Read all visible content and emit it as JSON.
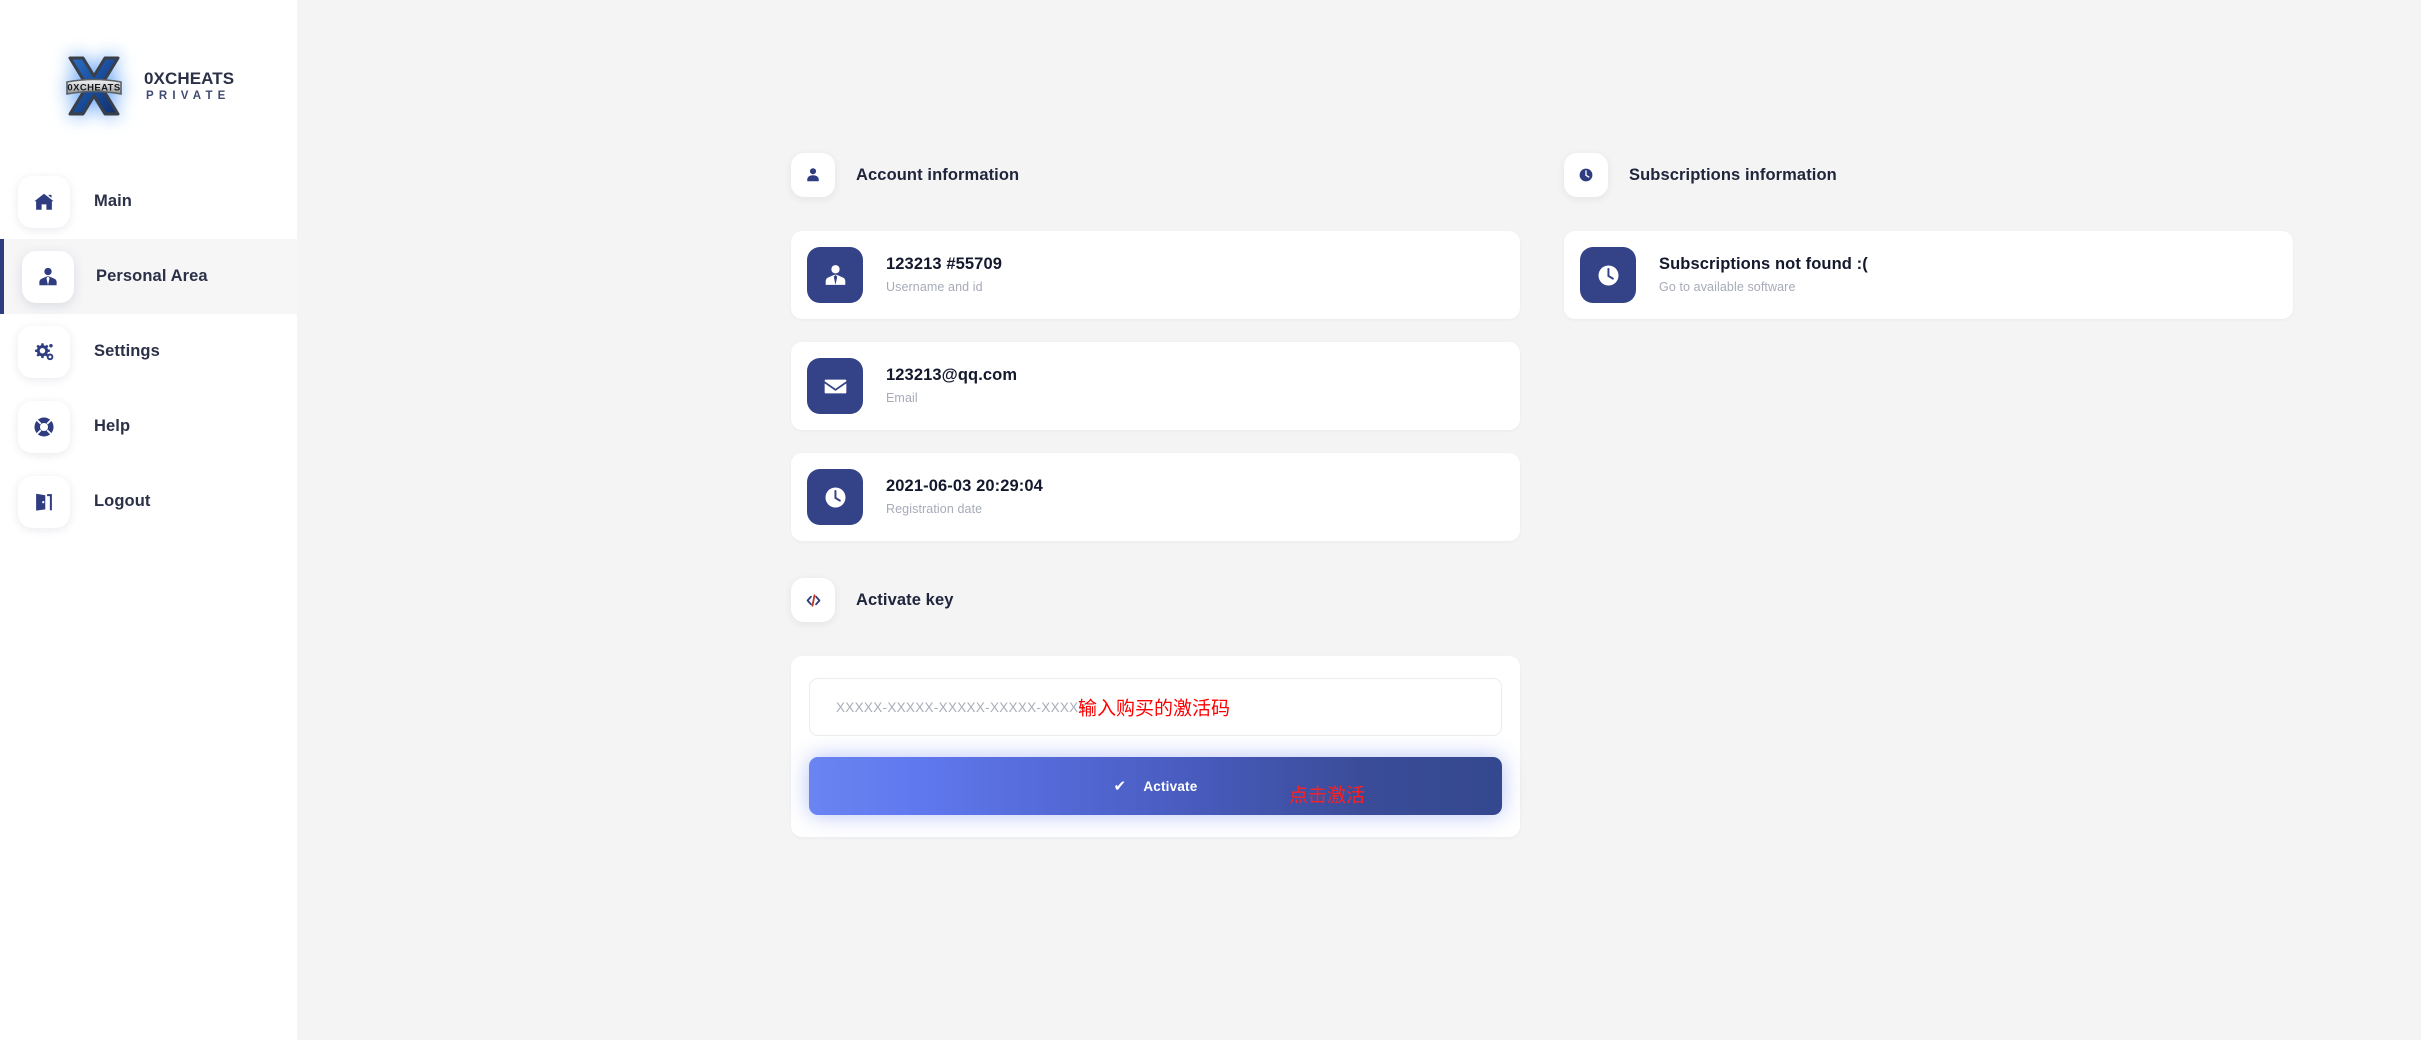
{
  "brand": {
    "title": "0XCHEATS",
    "subtitle": "PRIVATE",
    "logo_text": "0XCHEATS",
    "logo_letter": "X"
  },
  "sidebar": {
    "items": [
      {
        "label": "Main",
        "icon": "home-icon",
        "active": false
      },
      {
        "label": "Personal Area",
        "icon": "user-tie-icon",
        "active": true
      },
      {
        "label": "Settings",
        "icon": "gears-icon",
        "active": false
      },
      {
        "label": "Help",
        "icon": "life-ring-icon",
        "active": false
      },
      {
        "label": "Logout",
        "icon": "door-exit-icon",
        "active": false
      }
    ]
  },
  "account_section": {
    "heading": "Account information",
    "heading_icon": "user-icon",
    "cards": [
      {
        "primary": "123213 #55709",
        "secondary": "Username and id",
        "icon": "user-tie-icon"
      },
      {
        "primary": "123213@qq.com",
        "secondary": "Email",
        "icon": "envelope-icon"
      },
      {
        "primary": "2021-06-03 20:29:04",
        "secondary": "Registration date",
        "icon": "clock-icon"
      }
    ]
  },
  "subscriptions_section": {
    "heading": "Subscriptions information",
    "heading_icon": "clock-icon",
    "cards": [
      {
        "primary": "Subscriptions not found :(",
        "secondary": "Go to available software",
        "icon": "clock-icon"
      }
    ]
  },
  "activate_section": {
    "heading": "Activate key",
    "heading_icon": "code-icon",
    "key_input": {
      "value": "",
      "placeholder": "XXXXX-XXXXX-XXXXX-XXXXX-XXXXX"
    },
    "button_label": "Activate",
    "button_check_glyph": "✔",
    "annotation_input": "输入购买的激活码",
    "annotation_button": "点击激活"
  },
  "colors": {
    "page_background": "#f4f4f4",
    "sidebar_background": "#ffffff",
    "active_item_background": "#f6f6f7",
    "active_item_border": "#2f3c80",
    "icon_tile_navy": "#344288",
    "button_gradient_start": "#6a84f2",
    "button_gradient_end": "#34488f",
    "annotation_red": "#ff0000",
    "muted_text": "#a7abb8"
  }
}
